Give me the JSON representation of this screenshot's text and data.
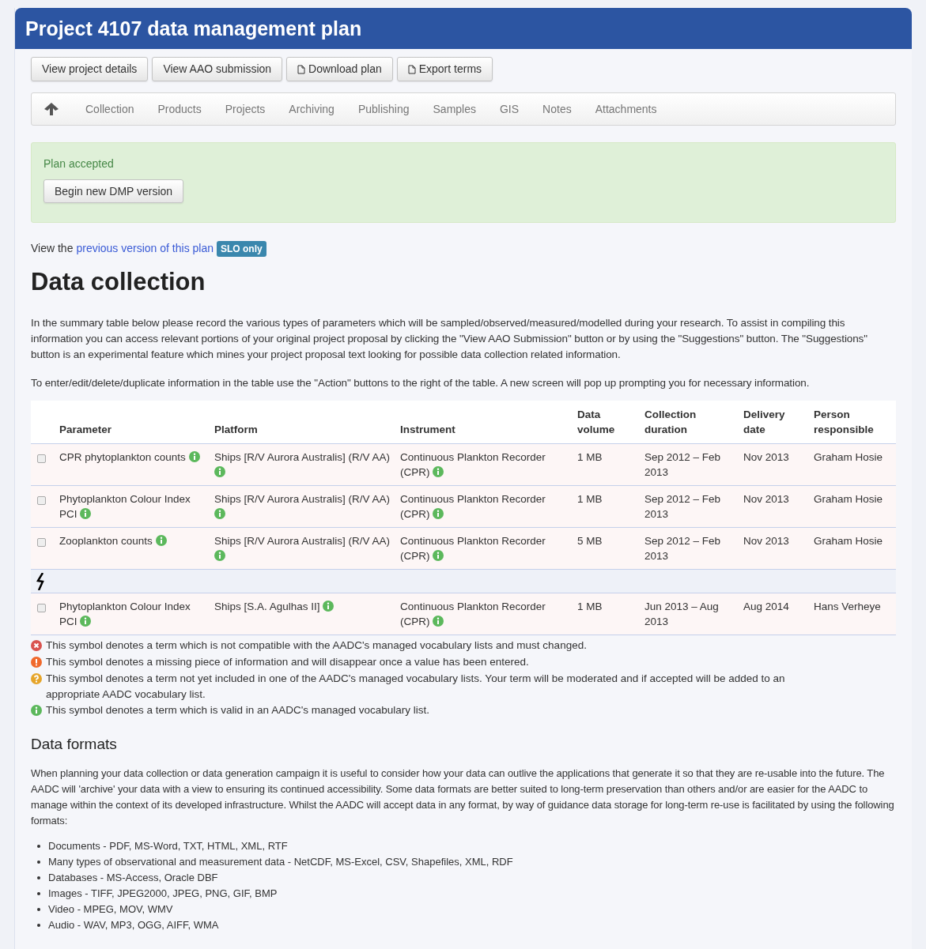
{
  "title": "Project 4107 data management plan",
  "actions": [
    {
      "label": "View project details",
      "has_icon": false
    },
    {
      "label": "View AAO submission",
      "has_icon": false
    },
    {
      "label": "Download plan",
      "has_icon": true
    },
    {
      "label": "Export terms",
      "has_icon": true
    }
  ],
  "nav": [
    {
      "kind": "up"
    },
    {
      "kind": "link",
      "label": "Collection"
    },
    {
      "kind": "link",
      "label": "Products"
    },
    {
      "kind": "link",
      "label": "Projects"
    },
    {
      "kind": "link",
      "label": "Archiving"
    },
    {
      "kind": "link",
      "label": "Publishing"
    },
    {
      "kind": "link",
      "label": "Samples"
    },
    {
      "kind": "link",
      "label": "GIS"
    },
    {
      "kind": "link",
      "label": "Notes"
    },
    {
      "kind": "link",
      "label": "Attachments"
    }
  ],
  "alert": {
    "message": "Plan accepted",
    "button": "Begin new DMP version"
  },
  "previous": {
    "prefix": "View the",
    "link": "previous version of this plan",
    "badge": "SLO only"
  },
  "heading": "Data collection",
  "intro": [
    "In the summary table below please record the various types of parameters which will be sampled/observed/measured/modelled during your research. To assist in compiling this information you can access relevant portions of your original project proposal by clicking the \"View AAO Submission\" button or by using the \"Suggestions\" button. The \"Suggestions\" button is an experimental feature which mines your project proposal text looking for possible data collection related information.",
    "To enter/edit/delete/duplicate information in the table use the \"Action\" buttons to the right of the table. A new screen will pop up prompting you for necessary information."
  ],
  "table": {
    "columns": [
      "Parameter",
      "Platform",
      "Instrument",
      "Data volume",
      "Collection duration",
      "Delivery date",
      "Person responsible"
    ],
    "rows": [
      {
        "kind": "entry",
        "checked": false,
        "parameter": {
          "text": "CPR phytoplankton counts",
          "valid": true
        },
        "platform": {
          "text": "Ships [R/V Aurora Australis] (R/V AA)",
          "valid": true
        },
        "instrument": {
          "text": "Continuous Plankton Recorder (CPR)",
          "valid": true
        },
        "volume": "1 MB",
        "duration": "Sep 2012 – Feb 2013",
        "delivery": "Nov 2013",
        "person": "Graham Hosie"
      },
      {
        "kind": "entry",
        "checked": false,
        "parameter": {
          "text": "Phytoplankton Colour Index PCI",
          "valid": true
        },
        "platform": {
          "text": "Ships [R/V Aurora Australis] (R/V AA)",
          "valid": true
        },
        "instrument": {
          "text": "Continuous Plankton Recorder (CPR)",
          "valid": true
        },
        "volume": "1 MB",
        "duration": "Sep 2012 – Feb 2013",
        "delivery": "Nov 2013",
        "person": "Graham Hosie"
      },
      {
        "kind": "entry",
        "checked": false,
        "parameter": {
          "text": "Zooplankton counts",
          "valid": true
        },
        "platform": {
          "text": "Ships [R/V Aurora Australis] (R/V AA)",
          "valid": true
        },
        "instrument": {
          "text": "Continuous Plankton Recorder (CPR)",
          "valid": true
        },
        "volume": "5 MB",
        "duration": "Sep 2012 – Feb 2013",
        "delivery": "Nov 2013",
        "person": "Graham Hosie"
      },
      {
        "kind": "break"
      },
      {
        "kind": "entry",
        "checked": false,
        "parameter": {
          "text": "Phytoplankton Colour Index PCI",
          "valid": true
        },
        "platform": {
          "text": "Ships [S.A. Agulhas II]",
          "valid": true
        },
        "instrument": {
          "text": "Continuous Plankton Recorder (CPR)",
          "valid": true
        },
        "volume": "1 MB",
        "duration": "Jun 2013 – Aug 2013",
        "delivery": "Aug 2014",
        "person": "Hans Verheye"
      }
    ]
  },
  "legend": [
    {
      "kind": "error",
      "text": "This symbol denotes a term which is not compatible with the AADC's managed vocabulary lists and must changed."
    },
    {
      "kind": "missing",
      "text": "This symbol denotes a missing piece of information and will disappear once a value has been entered."
    },
    {
      "kind": "suggested",
      "text": "This symbol denotes a term not yet included in one of the AADC's managed vocabulary lists. Your term will be moderated and if accepted will be added to an appropriate AADC vocabulary list."
    },
    {
      "kind": "valid",
      "text": "This symbol denotes a term which is valid in an AADC's managed vocabulary list."
    }
  ],
  "formats": {
    "heading": "Data formats",
    "text": "When planning your data collection or data generation campaign it is useful to consider how your data can outlive the applications that generate it so that they are re-usable into the future. The AADC will 'archive' your data with a view to ensuring its continued accessibility. Some data formats are better suited to long-term preservation than others and/or are easier for the AADC to manage within the context of its developed infrastructure. Whilst the AADC will accept data in any format, by way of guidance data storage for long-term re-use is facilitated by using the following formats:",
    "items": [
      "Documents - PDF, MS-Word, TXT, HTML, XML, RTF",
      "Many types of observational and measurement data - NetCDF, MS-Excel, CSV, Shapefiles, XML, RDF",
      "Databases - MS-Access, Oracle DBF",
      "Images - TIFF, JPEG2000, JPEG, PNG, GIF, BMP",
      "Video - MPEG, MOV, WMV",
      "Audio - WAV, MP3, OGG, AIFF, WMA"
    ]
  }
}
